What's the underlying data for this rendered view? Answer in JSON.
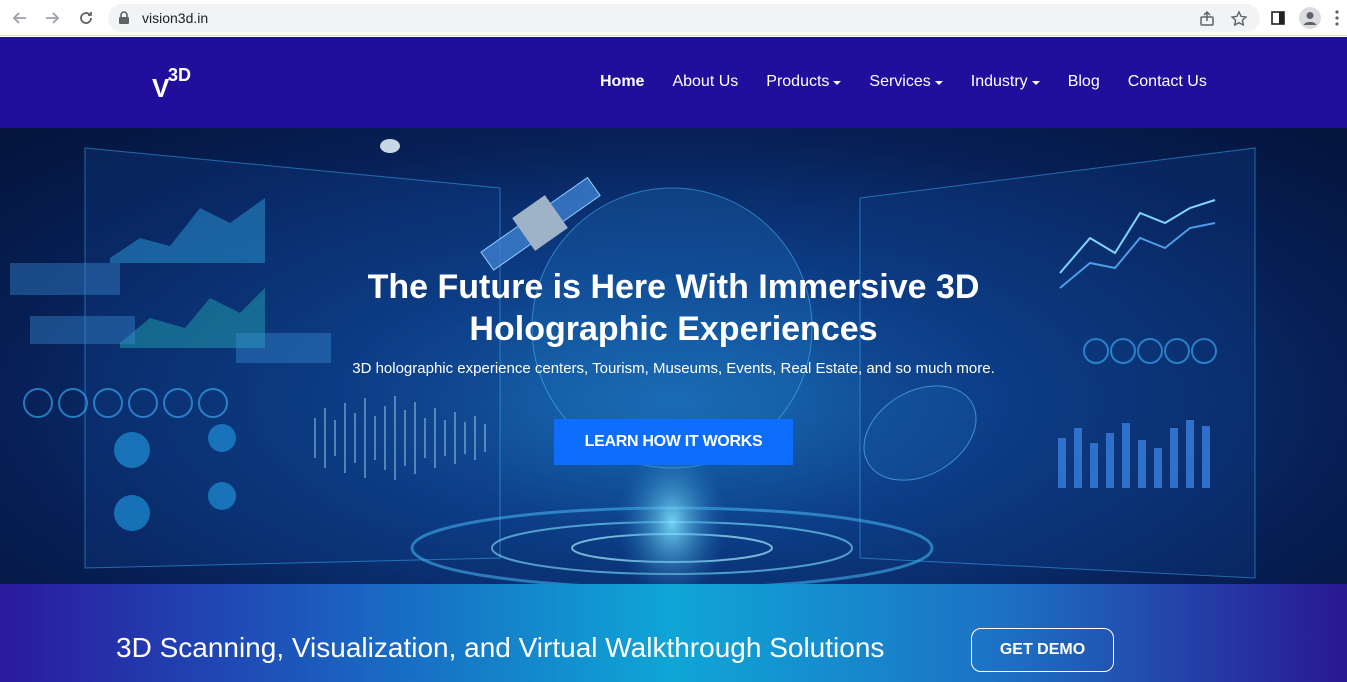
{
  "browser": {
    "url": "vision3d.in"
  },
  "header": {
    "logo_main": "V",
    "logo_sup": "3D",
    "nav": [
      {
        "label": "Home",
        "dropdown": false
      },
      {
        "label": "About Us",
        "dropdown": false
      },
      {
        "label": "Products",
        "dropdown": true
      },
      {
        "label": "Services",
        "dropdown": true
      },
      {
        "label": "Industry",
        "dropdown": true
      },
      {
        "label": "Blog",
        "dropdown": false
      },
      {
        "label": "Contact Us",
        "dropdown": false
      }
    ]
  },
  "hero": {
    "title_line1": "The Future is Here With Immersive 3D",
    "title_line2": "Holographic Experiences",
    "subtitle": "3D holographic experience centers, Tourism, Museums, Events, Real Estate, and so much more.",
    "cta": "LEARN HOW IT WORKS"
  },
  "banner": {
    "text": "3D Scanning, Visualization, and Virtual Walkthrough Solutions",
    "cta": "GET DEMO"
  },
  "colors": {
    "header_bg": "#1f0f9c",
    "cta_bg": "#0d6efd"
  }
}
